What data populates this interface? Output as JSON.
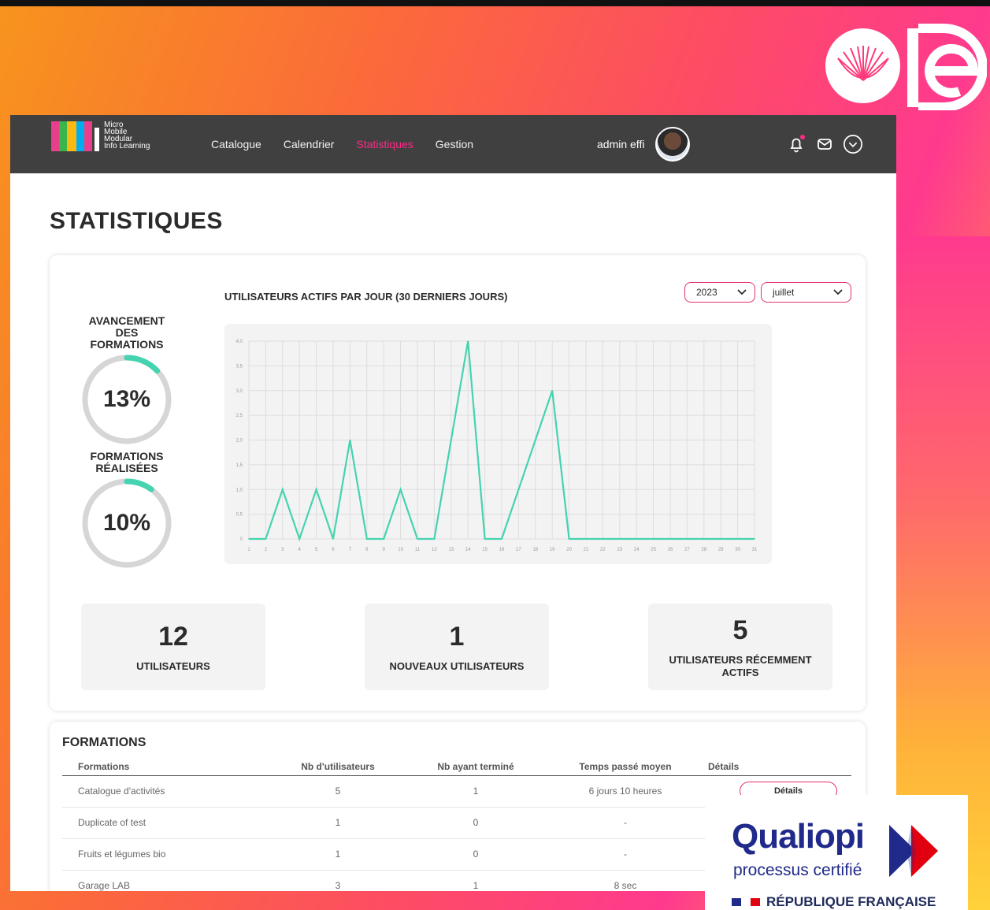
{
  "nav": {
    "brand_lines": [
      "Micro",
      "Mobile",
      "Modular",
      "Info Learning"
    ],
    "links": [
      {
        "label": "Catalogue",
        "active": false
      },
      {
        "label": "Calendrier",
        "active": false
      },
      {
        "label": "Statistiques",
        "active": true
      },
      {
        "label": "Gestion",
        "active": false
      }
    ],
    "user_name": "admin effi",
    "icons": [
      "bell-icon",
      "mail-icon",
      "chevron-down-circle-icon"
    ]
  },
  "page": {
    "title": "STATISTIQUES"
  },
  "gauges": [
    {
      "label": "AVANCEMENT DES FORMATIONS",
      "value_text": "13%",
      "percent": 13
    },
    {
      "label": "FORMATIONS RÉALISÉES",
      "value_text": "10%",
      "percent": 10
    }
  ],
  "filters": {
    "year": "2023",
    "month": "juillet"
  },
  "chart_data": {
    "type": "line",
    "title": "UTILISATEURS ACTIFS PAR JOUR (30 DERNIERS JOURS)",
    "x": [
      1,
      2,
      3,
      4,
      5,
      6,
      7,
      8,
      9,
      10,
      11,
      12,
      13,
      14,
      15,
      16,
      17,
      18,
      19,
      20,
      21,
      22,
      23,
      24,
      25,
      26,
      27,
      28,
      29,
      30,
      31
    ],
    "series": [
      {
        "values": [
          0,
          0,
          1,
          0,
          1,
          0,
          2,
          0,
          0,
          1,
          0,
          0,
          2,
          4,
          0,
          0,
          1,
          2,
          3,
          0,
          0,
          0,
          0,
          0,
          0,
          0,
          0,
          0,
          0,
          0,
          0
        ]
      }
    ],
    "ylim": [
      0,
      4.0
    ],
    "yticks": [
      "0",
      "0,5",
      "1,0",
      "1,5",
      "2,0",
      "2,5",
      "3,0",
      "3,5",
      "4,0"
    ],
    "grid": true,
    "color": "#45d3b0"
  },
  "stats": [
    {
      "value": "12",
      "label": "UTILISATEURS"
    },
    {
      "value": "1",
      "label": "NOUVEAUX UTILISATEURS"
    },
    {
      "value": "5",
      "label": "UTILISATEURS RÉCEMMENT ACTIFS"
    }
  ],
  "formations": {
    "title": "FORMATIONS",
    "columns": [
      "Formations",
      "Nb d'utilisateurs",
      "Nb ayant terminé",
      "Temps passé moyen",
      "Détails"
    ],
    "rows": [
      {
        "name": "Catalogue d'activités",
        "users": "5",
        "done": "1",
        "time": "6 jours 10 heures",
        "details": "Détails"
      },
      {
        "name": "Duplicate of test",
        "users": "1",
        "done": "0",
        "time": "-",
        "details": ""
      },
      {
        "name": "Fruits et légumes bio",
        "users": "1",
        "done": "0",
        "time": "-",
        "details": ""
      },
      {
        "name": "Garage LAB",
        "users": "3",
        "done": "1",
        "time": "8 sec",
        "details": ""
      }
    ]
  },
  "certification": {
    "brand": "Qualiopi",
    "subtitle": "processus certifié",
    "footer": "RÉPUBLIQUE FRANÇAISE"
  },
  "colors": {
    "accent": "#ff2a86",
    "teal": "#45d3b0",
    "navbar": "#404040"
  }
}
